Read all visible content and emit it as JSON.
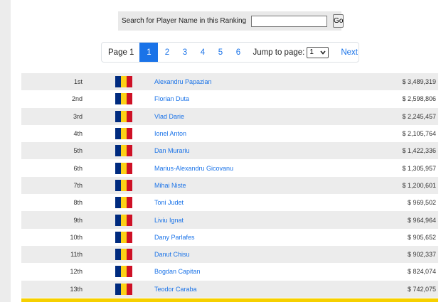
{
  "search": {
    "label": "Search for Player Name in this Ranking",
    "placeholder": "",
    "button_label": "Go"
  },
  "pagination": {
    "current_label": "Page 1",
    "pages": [
      "1",
      "2",
      "3",
      "4",
      "5",
      "6"
    ],
    "active_page": "1",
    "jump_label": "Jump to page:",
    "jump_value": "1",
    "next_label": "Next"
  },
  "flag_colors": [
    "#002b7f",
    "#fcd116",
    "#ce1126"
  ],
  "accent_color": "#1a73e8",
  "rankings": [
    {
      "rank": "1st",
      "name": "Alexandru Papazian",
      "prize": "$ 3,489,319"
    },
    {
      "rank": "2nd",
      "name": "Florian Duta",
      "prize": "$ 2,598,806"
    },
    {
      "rank": "3rd",
      "name": "Vlad Darie",
      "prize": "$ 2,245,457"
    },
    {
      "rank": "4th",
      "name": "Ionel Anton",
      "prize": "$ 2,105,764"
    },
    {
      "rank": "5th",
      "name": "Dan Murariu",
      "prize": "$ 1,422,336"
    },
    {
      "rank": "6th",
      "name": "Marius-Alexandru Gicovanu",
      "prize": "$ 1,305,957"
    },
    {
      "rank": "7th",
      "name": "Mihai Niste",
      "prize": "$ 1,200,601"
    },
    {
      "rank": "8th",
      "name": "Toni Judet",
      "prize": "$ 969,502"
    },
    {
      "rank": "9th",
      "name": "Liviu Ignat",
      "prize": "$ 964,964"
    },
    {
      "rank": "10th",
      "name": "Dany Parlafes",
      "prize": "$ 905,652"
    },
    {
      "rank": "11th",
      "name": "Danut Chisu",
      "prize": "$ 902,337"
    },
    {
      "rank": "12th",
      "name": "Bogdan Capitan",
      "prize": "$ 824,074"
    },
    {
      "rank": "13th",
      "name": "Teodor Caraba",
      "prize": "$ 742,075"
    }
  ]
}
